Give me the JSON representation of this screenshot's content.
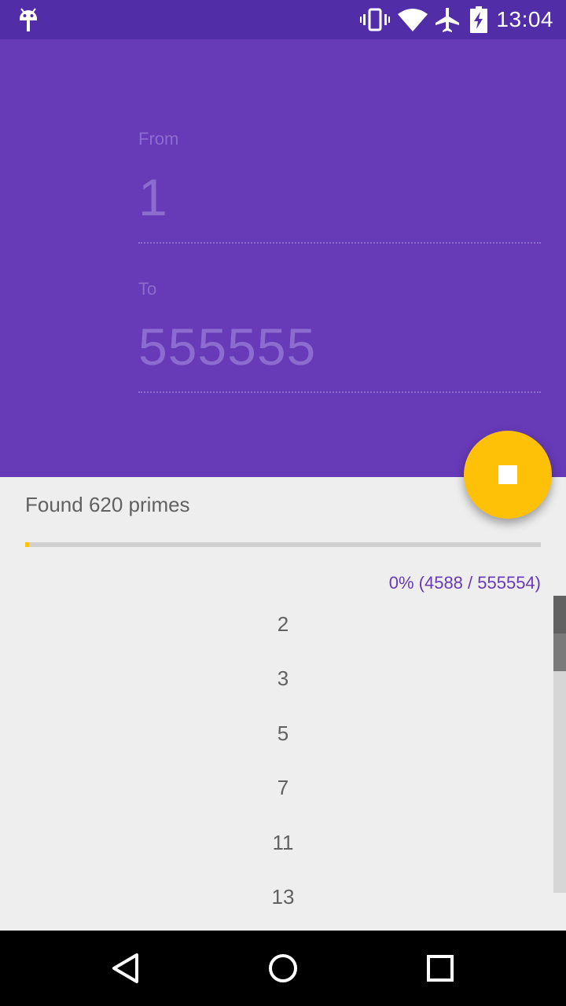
{
  "status_bar": {
    "time": "13:04",
    "icons": [
      "android-debug-icon",
      "vibrate-icon",
      "wifi-icon",
      "airplane-mode-icon",
      "battery-charging-icon"
    ]
  },
  "form": {
    "from_label": "From",
    "from_value": "1",
    "to_label": "To",
    "to_value": "555555"
  },
  "fab": {
    "icon": "stop-icon",
    "color": "#ffc107"
  },
  "results": {
    "found_text": "Found 620 primes",
    "progress_fraction": 0.0083,
    "progress_text": "0% (4588 / 555554)"
  },
  "primes": [
    "2",
    "3",
    "5",
    "7",
    "11",
    "13"
  ],
  "nav_bar": {
    "icons": [
      "back-icon",
      "home-icon",
      "recents-icon"
    ]
  },
  "colors": {
    "primary": "#673ab7",
    "primary_dark": "#512da8",
    "accent": "#ffc107",
    "background": "#eeeeee"
  }
}
